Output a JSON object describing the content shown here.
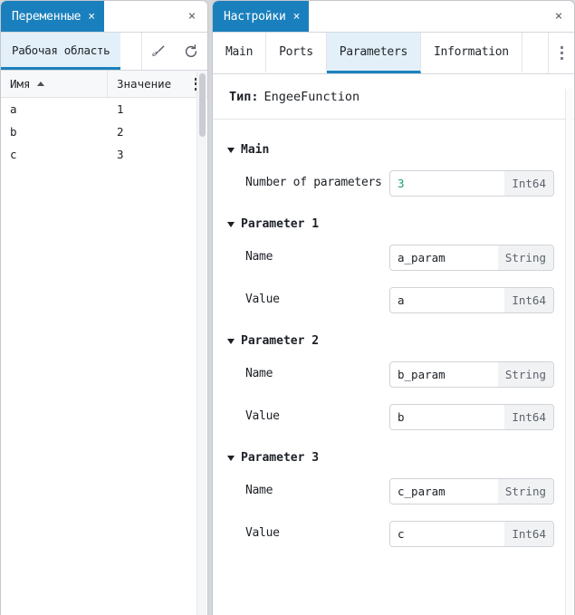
{
  "left_panel": {
    "tab": {
      "label": "Переменные",
      "close_icon": "×"
    },
    "panel_close_icon": "×",
    "subtab": {
      "label": "Рабочая область"
    },
    "toolbar": [
      {
        "name": "clear-variables-button",
        "icon": "broom-icon"
      },
      {
        "name": "refresh-variables-button",
        "icon": "refresh-icon"
      }
    ],
    "table": {
      "columns": [
        "Имя",
        "Значение"
      ],
      "sort": {
        "column": "Имя",
        "direction": "asc"
      },
      "menu_icon": "kebab-menu-icon",
      "rows": [
        {
          "name": "a",
          "value": "1"
        },
        {
          "name": "b",
          "value": "2"
        },
        {
          "name": "c",
          "value": "3"
        }
      ]
    }
  },
  "right_panel": {
    "tab": {
      "label": "Настройки",
      "close_icon": "×"
    },
    "panel_close_icon": "×",
    "tabs": [
      {
        "label": "Main",
        "active": false
      },
      {
        "label": "Ports",
        "active": false
      },
      {
        "label": "Parameters",
        "active": true
      },
      {
        "label": "Information",
        "active": false
      }
    ],
    "overflow_icon": "kebab-menu-icon",
    "type_row": {
      "label": "Тип:",
      "value": "EngeeFunction"
    },
    "sections": [
      {
        "title": "Main",
        "fields": [
          {
            "label": "Number of parameters",
            "value": "3",
            "type": "Int64",
            "numeric": true
          }
        ]
      },
      {
        "title": "Parameter 1",
        "fields": [
          {
            "label": "Name",
            "value": "a_param",
            "type": "String",
            "numeric": false
          },
          {
            "label": "Value",
            "value": "a",
            "type": "Int64",
            "numeric": false
          }
        ]
      },
      {
        "title": "Parameter 2",
        "fields": [
          {
            "label": "Name",
            "value": "b_param",
            "type": "String",
            "numeric": false
          },
          {
            "label": "Value",
            "value": "b",
            "type": "Int64",
            "numeric": false
          }
        ]
      },
      {
        "title": "Parameter 3",
        "fields": [
          {
            "label": "Name",
            "value": "c_param",
            "type": "String",
            "numeric": false
          },
          {
            "label": "Value",
            "value": "c",
            "type": "Int64",
            "numeric": false
          }
        ]
      }
    ]
  },
  "colors": {
    "accent": "#1a80bd",
    "accent_soft": "#e3f0f9",
    "numeric_value": "#1a9e76",
    "panel_bg": "#ffffff",
    "desktop_bg": "#d5d7db"
  }
}
